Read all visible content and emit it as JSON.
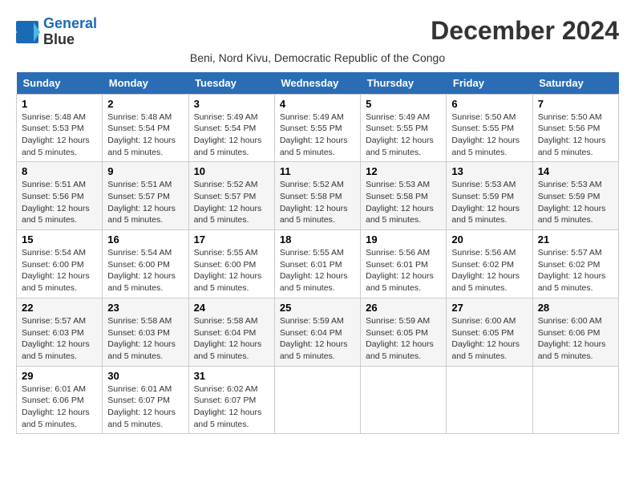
{
  "logo": {
    "line1": "General",
    "line2": "Blue"
  },
  "title": "December 2024",
  "subtitle": "Beni, Nord Kivu, Democratic Republic of the Congo",
  "headers": [
    "Sunday",
    "Monday",
    "Tuesday",
    "Wednesday",
    "Thursday",
    "Friday",
    "Saturday"
  ],
  "weeks": [
    [
      {
        "day": "1",
        "info": "Sunrise: 5:48 AM\nSunset: 5:53 PM\nDaylight: 12 hours\nand 5 minutes."
      },
      {
        "day": "2",
        "info": "Sunrise: 5:48 AM\nSunset: 5:54 PM\nDaylight: 12 hours\nand 5 minutes."
      },
      {
        "day": "3",
        "info": "Sunrise: 5:49 AM\nSunset: 5:54 PM\nDaylight: 12 hours\nand 5 minutes."
      },
      {
        "day": "4",
        "info": "Sunrise: 5:49 AM\nSunset: 5:55 PM\nDaylight: 12 hours\nand 5 minutes."
      },
      {
        "day": "5",
        "info": "Sunrise: 5:49 AM\nSunset: 5:55 PM\nDaylight: 12 hours\nand 5 minutes."
      },
      {
        "day": "6",
        "info": "Sunrise: 5:50 AM\nSunset: 5:55 PM\nDaylight: 12 hours\nand 5 minutes."
      },
      {
        "day": "7",
        "info": "Sunrise: 5:50 AM\nSunset: 5:56 PM\nDaylight: 12 hours\nand 5 minutes."
      }
    ],
    [
      {
        "day": "8",
        "info": "Sunrise: 5:51 AM\nSunset: 5:56 PM\nDaylight: 12 hours\nand 5 minutes."
      },
      {
        "day": "9",
        "info": "Sunrise: 5:51 AM\nSunset: 5:57 PM\nDaylight: 12 hours\nand 5 minutes."
      },
      {
        "day": "10",
        "info": "Sunrise: 5:52 AM\nSunset: 5:57 PM\nDaylight: 12 hours\nand 5 minutes."
      },
      {
        "day": "11",
        "info": "Sunrise: 5:52 AM\nSunset: 5:58 PM\nDaylight: 12 hours\nand 5 minutes."
      },
      {
        "day": "12",
        "info": "Sunrise: 5:53 AM\nSunset: 5:58 PM\nDaylight: 12 hours\nand 5 minutes."
      },
      {
        "day": "13",
        "info": "Sunrise: 5:53 AM\nSunset: 5:59 PM\nDaylight: 12 hours\nand 5 minutes."
      },
      {
        "day": "14",
        "info": "Sunrise: 5:53 AM\nSunset: 5:59 PM\nDaylight: 12 hours\nand 5 minutes."
      }
    ],
    [
      {
        "day": "15",
        "info": "Sunrise: 5:54 AM\nSunset: 6:00 PM\nDaylight: 12 hours\nand 5 minutes."
      },
      {
        "day": "16",
        "info": "Sunrise: 5:54 AM\nSunset: 6:00 PM\nDaylight: 12 hours\nand 5 minutes."
      },
      {
        "day": "17",
        "info": "Sunrise: 5:55 AM\nSunset: 6:00 PM\nDaylight: 12 hours\nand 5 minutes."
      },
      {
        "day": "18",
        "info": "Sunrise: 5:55 AM\nSunset: 6:01 PM\nDaylight: 12 hours\nand 5 minutes."
      },
      {
        "day": "19",
        "info": "Sunrise: 5:56 AM\nSunset: 6:01 PM\nDaylight: 12 hours\nand 5 minutes."
      },
      {
        "day": "20",
        "info": "Sunrise: 5:56 AM\nSunset: 6:02 PM\nDaylight: 12 hours\nand 5 minutes."
      },
      {
        "day": "21",
        "info": "Sunrise: 5:57 AM\nSunset: 6:02 PM\nDaylight: 12 hours\nand 5 minutes."
      }
    ],
    [
      {
        "day": "22",
        "info": "Sunrise: 5:57 AM\nSunset: 6:03 PM\nDaylight: 12 hours\nand 5 minutes."
      },
      {
        "day": "23",
        "info": "Sunrise: 5:58 AM\nSunset: 6:03 PM\nDaylight: 12 hours\nand 5 minutes."
      },
      {
        "day": "24",
        "info": "Sunrise: 5:58 AM\nSunset: 6:04 PM\nDaylight: 12 hours\nand 5 minutes."
      },
      {
        "day": "25",
        "info": "Sunrise: 5:59 AM\nSunset: 6:04 PM\nDaylight: 12 hours\nand 5 minutes."
      },
      {
        "day": "26",
        "info": "Sunrise: 5:59 AM\nSunset: 6:05 PM\nDaylight: 12 hours\nand 5 minutes."
      },
      {
        "day": "27",
        "info": "Sunrise: 6:00 AM\nSunset: 6:05 PM\nDaylight: 12 hours\nand 5 minutes."
      },
      {
        "day": "28",
        "info": "Sunrise: 6:00 AM\nSunset: 6:06 PM\nDaylight: 12 hours\nand 5 minutes."
      }
    ],
    [
      {
        "day": "29",
        "info": "Sunrise: 6:01 AM\nSunset: 6:06 PM\nDaylight: 12 hours\nand 5 minutes."
      },
      {
        "day": "30",
        "info": "Sunrise: 6:01 AM\nSunset: 6:07 PM\nDaylight: 12 hours\nand 5 minutes."
      },
      {
        "day": "31",
        "info": "Sunrise: 6:02 AM\nSunset: 6:07 PM\nDaylight: 12 hours\nand 5 minutes."
      },
      null,
      null,
      null,
      null
    ]
  ]
}
